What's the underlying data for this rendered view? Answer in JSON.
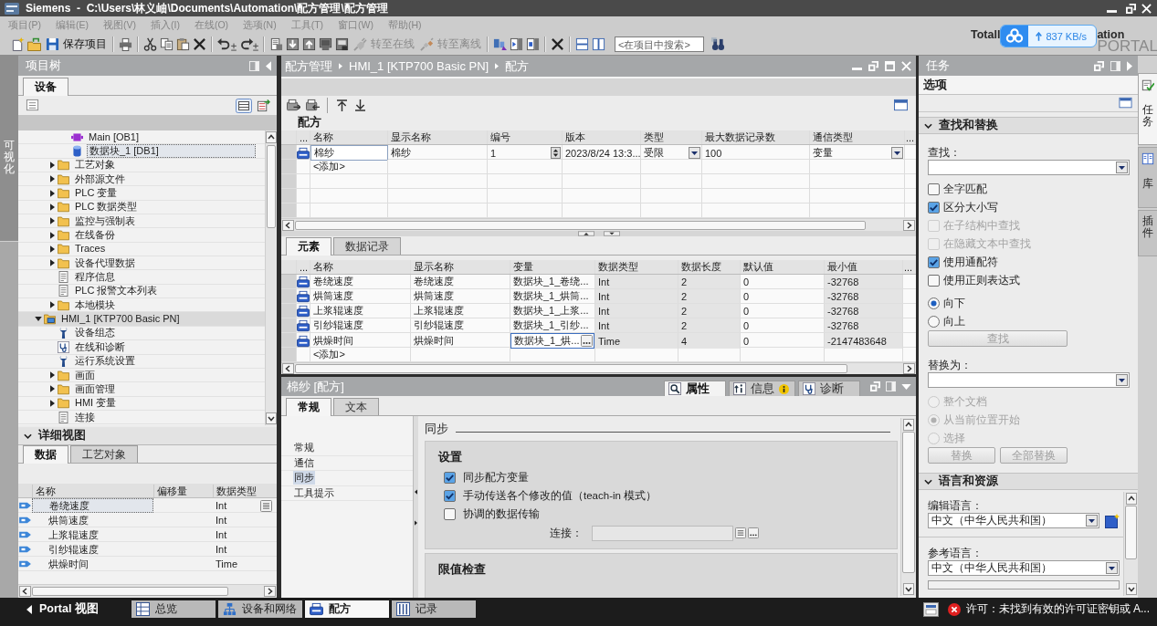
{
  "window": {
    "title": "Siemens  -  C:\\Users\\林义岫\\Documents\\Automation\\配方管理\\配方管理"
  },
  "menu": [
    {
      "label": "项目(P)",
      "disabled": true
    },
    {
      "label": "编辑(E)",
      "disabled": true
    },
    {
      "label": "视图(V)",
      "disabled": true
    },
    {
      "label": "插入(I)",
      "disabled": true
    },
    {
      "label": "在线(O)",
      "disabled": true
    },
    {
      "label": "选项(N)",
      "disabled": true
    },
    {
      "label": "工具(T)",
      "disabled": true
    },
    {
      "label": "窗口(W)",
      "disabled": true
    },
    {
      "label": "帮助(H)",
      "disabled": true
    }
  ],
  "toolbar": {
    "buttons": [
      {
        "label": "保存项目",
        "disabled": false
      },
      {
        "label": "转至在线",
        "disabled": true
      },
      {
        "label": "转至离线",
        "disabled": true
      }
    ],
    "search": {
      "placeholder": "<在项目中搜索>"
    }
  },
  "brand": {
    "line1": [
      "Totall",
      "ation"
    ],
    "line2": "PORTAL"
  },
  "transfer_widget": {
    "speed": "837 KB/s"
  },
  "left_strip": {
    "label": "可视化"
  },
  "project_tree": {
    "title": "项目树",
    "tabs": [
      {
        "label": "设备",
        "selected": true
      }
    ],
    "items": [
      {
        "children": [
          {
            "children": [
              {
                "label": "Main [OB1]",
                "kind": "block",
                "selected": false
              },
              {
                "label": "数据块_1 [DB1]",
                "kind": "database",
                "selected": true
              }
            ]
          },
          {
            "label": "工艺对象",
            "kind": "folder",
            "expanded": false,
            "selected": false
          },
          {
            "label": "外部源文件",
            "kind": "folder",
            "expanded": false,
            "selected": false
          },
          {
            "label": "PLC 变量",
            "kind": "folder",
            "expanded": false,
            "selected": false
          },
          {
            "label": "PLC 数据类型",
            "kind": "folder",
            "expanded": false,
            "selected": false
          },
          {
            "label": "监控与强制表",
            "kind": "folder",
            "expanded": false,
            "selected": false
          },
          {
            "label": "在线备份",
            "kind": "folder",
            "expanded": false,
            "selected": false
          },
          {
            "label": "Traces",
            "kind": "folder",
            "expanded": false,
            "selected": false
          },
          {
            "label": "设备代理数据",
            "kind": "folder",
            "expanded": false,
            "selected": false
          },
          {
            "label": "程序信息",
            "kind": "document",
            "selected": false
          },
          {
            "label": "PLC 报警文本列表",
            "kind": "document",
            "selected": false
          },
          {
            "label": "本地模块",
            "kind": "folder",
            "expanded": false,
            "selected": false
          }
        ]
      },
      {
        "label": "HMI_1 [KTP700 Basic PN]",
        "kind": "device",
        "expanded": true,
        "selected": false,
        "children": [
          {
            "label": "设备组态",
            "kind": "wrench",
            "selected": false
          },
          {
            "label": "在线和诊断",
            "kind": "diagnostics",
            "selected": false
          },
          {
            "label": "运行系统设置",
            "kind": "wrench",
            "selected": false
          },
          {
            "label": "画面",
            "kind": "folder",
            "expanded": false,
            "selected": false
          },
          {
            "label": "画面管理",
            "kind": "folder",
            "expanded": false,
            "selected": false
          },
          {
            "label": "HMI 变量",
            "kind": "folder",
            "expanded": false,
            "selected": false
          },
          {
            "label": "连接",
            "kind": "document",
            "selected": false
          }
        ]
      }
    ]
  },
  "detail_view": {
    "title": "详细视图",
    "expanded": true,
    "tabs": [
      {
        "label": "数据",
        "selected": true
      },
      {
        "label": "工艺对象",
        "selected": false
      }
    ],
    "columns": [
      "名称",
      "偏移量",
      "数据类型"
    ],
    "rows": [
      {
        "name": "卷绕速度",
        "data_type": "Int",
        "selected": true
      },
      {
        "name": "烘筒速度",
        "data_type": "Int",
        "selected": false
      },
      {
        "name": "上浆辊速度",
        "data_type": "Int",
        "selected": false
      },
      {
        "name": "引纱辊速度",
        "data_type": "Int",
        "selected": false
      },
      {
        "name": "烘燥时间",
        "data_type": "Time",
        "selected": false
      }
    ]
  },
  "editor": {
    "breadcrumb": [
      "配方管理",
      "HMI_1 [KTP700 Basic PN]",
      "配方"
    ],
    "recipes": {
      "title": "配方",
      "columns": [
        "...",
        "名称",
        "显示名称",
        "编号",
        "版本",
        "类型",
        "最大数据记录数",
        "通信类型",
        "..."
      ],
      "rows": [
        {
          "name": "棉纱",
          "display_name": "棉纱",
          "number": "1",
          "version": "2023/8/24 13:3...",
          "type": "受限",
          "max_records": "100",
          "comm_type": "变量",
          "selected": true
        }
      ],
      "add_label": "<添加>"
    },
    "element_tabs": [
      {
        "label": "元素",
        "selected": true
      },
      {
        "label": "数据记录",
        "selected": false
      }
    ],
    "elements": {
      "icon_column_header": "...",
      "columns": [
        {
          "label": "名称",
          "readonly": false
        },
        {
          "label": "显示名称",
          "readonly": false
        },
        {
          "label": "变量",
          "readonly": false
        },
        {
          "label": "数据类型",
          "readonly": true
        },
        {
          "label": "数据长度",
          "readonly": true
        },
        {
          "label": "默认值",
          "readonly": false
        },
        {
          "label": "最小值",
          "readonly": true
        }
      ],
      "more_column_header": "...",
      "rows": [
        {
          "name": "卷绕速度",
          "display_name": "卷绕速度",
          "tag": "数据块_1_卷绕...",
          "data_type": "Int",
          "length": "2",
          "default": "0",
          "min": "-32768",
          "editing": false
        },
        {
          "name": "烘筒速度",
          "display_name": "烘筒速度",
          "tag": "数据块_1_烘筒...",
          "data_type": "Int",
          "length": "2",
          "default": "0",
          "min": "-32768",
          "editing": false
        },
        {
          "name": "上浆辊速度",
          "display_name": "上浆辊速度",
          "tag": "数据块_1_上浆...",
          "data_type": "Int",
          "length": "2",
          "default": "0",
          "min": "-32768",
          "editing": false
        },
        {
          "name": "引纱辊速度",
          "display_name": "引纱辊速度",
          "tag": "数据块_1_引纱...",
          "data_type": "Int",
          "length": "2",
          "default": "0",
          "min": "-32768",
          "editing": false
        },
        {
          "name": "烘燥时间",
          "display_name": "烘燥时间",
          "tag": "数据块_1_烘...",
          "data_type": "Time",
          "length": "4",
          "default": "0",
          "min": "-2147483648",
          "editing": true
        }
      ],
      "add_label": "<添加>"
    }
  },
  "properties": {
    "title": "棉纱 [配方]",
    "inspector_tabs": [
      {
        "label": "属性",
        "kind": "properties",
        "selected": true
      },
      {
        "label": "信息",
        "kind": "info",
        "selected": false
      },
      {
        "label": "诊断",
        "kind": "diagnostics",
        "selected": false
      }
    ],
    "tabs": [
      {
        "label": "常规",
        "selected": true
      },
      {
        "label": "文本",
        "selected": false
      }
    ],
    "nav": [
      {
        "label": "常规",
        "selected": false
      },
      {
        "label": "通信",
        "selected": false
      },
      {
        "label": "同步",
        "selected": true
      },
      {
        "label": "工具提示",
        "selected": false
      }
    ],
    "section_title": "同步",
    "settings": {
      "title": "设置",
      "options": [
        {
          "label": "同步配方变量",
          "checked": true
        },
        {
          "label": "手动传送各个修改的值（teach-in 模式）",
          "checked": true
        },
        {
          "label": "协调的数据传输",
          "checked": false
        }
      ],
      "connection": {
        "label": "连接：",
        "disabled": true
      }
    },
    "limits": {
      "title": "限值检查"
    }
  },
  "tasks": {
    "title": "任务",
    "options_title": "选项",
    "find_replace": {
      "title": "查找和替换",
      "expanded": true,
      "find_label": "查找：",
      "options": [
        {
          "label": "全字匹配",
          "checked": false,
          "disabled": false
        },
        {
          "label": "区分大小写",
          "checked": true,
          "disabled": false
        },
        {
          "label": "在子结构中查找",
          "checked": false,
          "disabled": true
        },
        {
          "label": "在隐藏文本中查找",
          "checked": false,
          "disabled": true
        },
        {
          "label": "使用通配符",
          "checked": true,
          "disabled": false
        },
        {
          "label": "使用正则表达式",
          "checked": false,
          "disabled": false
        }
      ],
      "directions": [
        {
          "label": "向下",
          "selected": true
        },
        {
          "label": "向上",
          "selected": false
        }
      ],
      "find_button": {
        "label": "查找",
        "disabled": true
      },
      "replace_label": "替换为：",
      "scopes": [
        {
          "label": "整个文档",
          "selected": false,
          "disabled": true
        },
        {
          "label": "从当前位置开始",
          "selected": true,
          "disabled": true
        },
        {
          "label": "选择",
          "selected": false,
          "disabled": true
        }
      ],
      "replace_buttons": [
        {
          "label": "替换",
          "disabled": true
        },
        {
          "label": "全部替换",
          "disabled": true
        }
      ]
    },
    "languages": {
      "title": "语言和资源",
      "expanded": true,
      "fields": [
        {
          "label": "编辑语言：",
          "value": "中文（中华人民共和国）"
        },
        {
          "label": "参考语言：",
          "value": "中文（中华人民共和国）"
        }
      ]
    }
  },
  "side_tabs": [
    {
      "label": "任务",
      "kind": "tasks",
      "selected": true
    },
    {
      "label": "库",
      "kind": "library",
      "selected": false
    },
    {
      "label": "插件",
      "kind": "plugins",
      "selected": false
    }
  ],
  "taskbar": {
    "portal_label": "Portal 视图",
    "tabs": [
      {
        "label": "总览",
        "kind": "overview",
        "selected": false
      },
      {
        "label": "设备和网络",
        "kind": "network",
        "selected": false
      },
      {
        "label": "配方",
        "kind": "recipe",
        "selected": true
      },
      {
        "label": "记录",
        "kind": "records",
        "selected": false
      }
    ],
    "status": "许可：未找到有效的许可证密钥或 A..."
  }
}
